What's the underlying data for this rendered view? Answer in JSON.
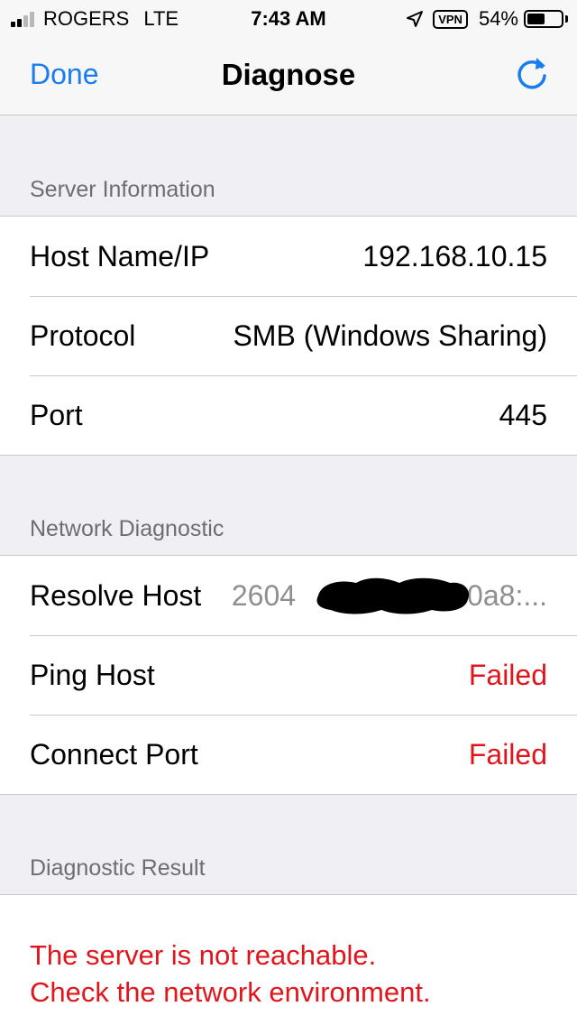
{
  "status_bar": {
    "carrier": "ROGERS",
    "network": "LTE",
    "time": "7:43 AM",
    "vpn": "VPN",
    "battery_percent": "54%",
    "battery_level": 0.54,
    "signal_bars_active": 2,
    "signal_bars_total": 4
  },
  "nav": {
    "done_label": "Done",
    "title": "Diagnose",
    "refresh_icon": "refresh-icon"
  },
  "server_information": {
    "header": "Server Information",
    "rows": [
      {
        "label": "Host Name/IP",
        "value": "192.168.10.15"
      },
      {
        "label": "Protocol",
        "value": "SMB (Windows Sharing)"
      },
      {
        "label": "Port",
        "value": "445"
      }
    ]
  },
  "network_diagnostic": {
    "header": "Network Diagnostic",
    "rows": [
      {
        "label": "Resolve Host",
        "value": "2604",
        "value_tail": "0a8:..."
      },
      {
        "label": "Ping Host",
        "value": "Failed"
      },
      {
        "label": "Connect Port",
        "value": "Failed"
      }
    ]
  },
  "diagnostic_result": {
    "header": "Diagnostic Result",
    "line1": "The server is not reachable.",
    "line2": "Check the network environment."
  },
  "colors": {
    "accent": "#1a7cf1",
    "error": "#e0161c",
    "background": "#efeff4",
    "secondary_text": "#6d6d72"
  }
}
